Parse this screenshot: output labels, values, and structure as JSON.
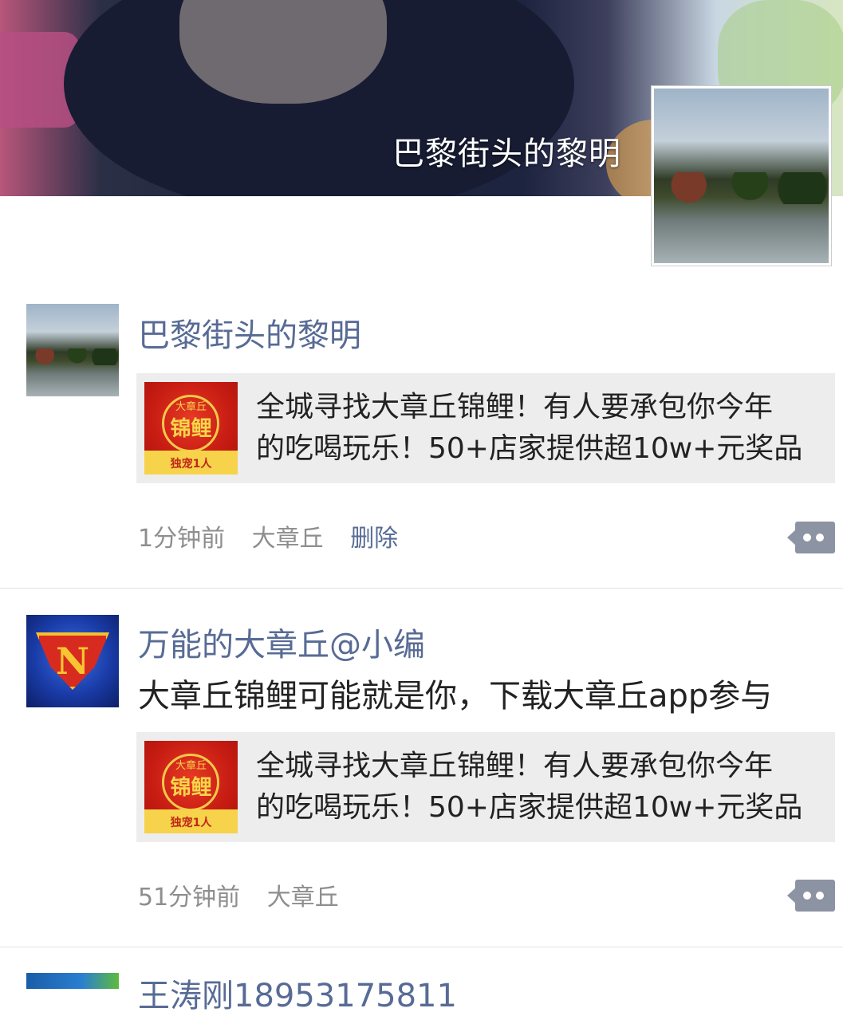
{
  "cover": {
    "owner_name": "巴黎街头的黎明"
  },
  "posts": [
    {
      "author": "巴黎街头的黎明",
      "text": "",
      "link_card": {
        "thumb_top": "大章丘",
        "thumb_main": "锦鲤",
        "thumb_bottom": "独宠1人",
        "title_line1": "全城寻找大章丘锦鲤！有人要承包你今年",
        "title_line2": "的吃喝玩乐！50+店家提供超10w+元奖品"
      },
      "time": "1分钟前",
      "location": "大章丘",
      "delete_label": "删除"
    },
    {
      "author": "万能的大章丘@小编",
      "avatar_letter": "N",
      "text": "大章丘锦鲤可能就是你，下载大章丘app参与",
      "link_card": {
        "thumb_top": "大章丘",
        "thumb_main": "锦鲤",
        "thumb_bottom": "独宠1人",
        "title_line1": "全城寻找大章丘锦鲤！有人要承包你今年",
        "title_line2": "的吃喝玩乐！50+店家提供超10w+元奖品"
      },
      "time": "51分钟前",
      "location": "大章丘"
    },
    {
      "author": "王涛刚18953175811"
    }
  ],
  "colors": {
    "link_blue": "#576b95",
    "meta_gray": "#8e8e8e",
    "card_bg": "#ededed"
  }
}
